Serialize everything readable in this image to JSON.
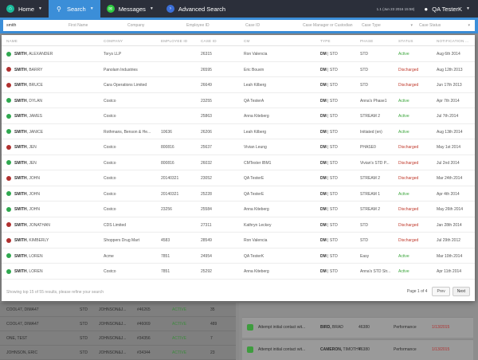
{
  "nav": {
    "home": "Home",
    "search": "Search",
    "messages": "Messages",
    "advanced_search": "Advanced Search",
    "version": "1.1 (Jun 23 2016 15:58)",
    "user": "QA TesterK"
  },
  "search": {
    "query": "smith",
    "first_name": "First Name",
    "company": "Company",
    "employee_id": "Employee ID",
    "case_id": "Case ID",
    "case_manager": "Case Manager or Custodian",
    "case_type": "Case Type",
    "case_status": "Case Status"
  },
  "columns": {
    "name": "NAME",
    "company": "COMPANY",
    "employee_id": "EMPLOYEE ID",
    "case_id": "CASE ID",
    "cm": "CM",
    "type": "TYPE",
    "phase": "PHASE",
    "status": "STATUS",
    "notification": "NOTIFICATION ..."
  },
  "rows": [
    {
      "last": "SMITH",
      "first": "ALEXANDER",
      "company": "Torys LLP",
      "emp": "",
      "case": "26315",
      "cm": "Ron Valencia",
      "type_a": "DM",
      "type_b": "STD",
      "phase": "STD",
      "status": "Active",
      "notif": "Aug 6th 2014",
      "color": "#2fa84f"
    },
    {
      "last": "SMITH",
      "first": "BARRY",
      "company": "Panolam Industries",
      "emp": "",
      "case": "26595",
      "cm": "Eric Bouvin",
      "type_a": "DM",
      "type_b": "STD",
      "phase": "STD",
      "status": "Discharged",
      "notif": "Aug 12th 2013",
      "color": "#b0302f"
    },
    {
      "last": "SMITH",
      "first": "BRUCE",
      "company": "Cara Operations Limited",
      "emp": "",
      "case": "26649",
      "cm": "Leah Kilberg",
      "type_a": "DM",
      "type_b": "STD",
      "phase": "STD",
      "status": "Discharged",
      "notif": "Jun 17th 2013",
      "color": "#b0302f"
    },
    {
      "last": "SMITH",
      "first": "DYLAN",
      "company": "Costco",
      "emp": "",
      "case": "23255",
      "cm": "QA TesterA",
      "type_a": "DM",
      "type_b": "STD",
      "phase": "Anna's Phase1",
      "status": "Active",
      "notif": "Apr 7th 2014",
      "color": "#2fa84f"
    },
    {
      "last": "SMITH",
      "first": "JAMES",
      "company": "Costco",
      "emp": "",
      "case": "25863",
      "cm": "Anna Kiteberg",
      "type_a": "DM",
      "type_b": "STD",
      "phase": "STREAM 2",
      "status": "Active",
      "notif": "Jul 7th 2014",
      "color": "#2fa84f"
    },
    {
      "last": "SMITH",
      "first": "JANICE",
      "company": "Rothmans, Benson & He...",
      "emp": "10636",
      "case": "26206",
      "cm": "Leah Kilberg",
      "type_a": "DM",
      "type_b": "STD",
      "phase": "Initiated (en)",
      "status": "Active",
      "notif": "Aug 13th 2014",
      "color": "#2fa84f"
    },
    {
      "last": "SMITH",
      "first": "JEN",
      "company": "Costco",
      "emp": "800816",
      "case": "25637",
      "cm": "Vivian Leung",
      "type_a": "DM",
      "type_b": "STD",
      "phase": "PHASE0",
      "status": "Discharged",
      "notif": "May 1st 2014",
      "color": "#b0302f"
    },
    {
      "last": "SMITH",
      "first": "JEN",
      "company": "Costco",
      "emp": "800816",
      "case": "26032",
      "cm": "CMTester IBM1",
      "type_a": "DM",
      "type_b": "STD",
      "phase": "Vivian's STD P...",
      "status": "Discharged",
      "notif": "Jul 2nd 2014",
      "color": "#2fa84f"
    },
    {
      "last": "SMITH",
      "first": "JOHN",
      "company": "Costco",
      "emp": "20140321",
      "case": "23052",
      "cm": "QA TesterE",
      "type_a": "DM",
      "type_b": "STD",
      "phase": "STREAM 2",
      "status": "Discharged",
      "notif": "Mar 24th 2014",
      "color": "#b0302f"
    },
    {
      "last": "SMITH",
      "first": "JOHN",
      "company": "Costco",
      "emp": "20140321",
      "case": "25228",
      "cm": "QA TesterE",
      "type_a": "DM",
      "type_b": "STD",
      "phase": "STREAM 1",
      "status": "Active",
      "notif": "Apr 4th 2014",
      "color": "#2fa84f"
    },
    {
      "last": "SMITH",
      "first": "JOHN",
      "company": "Costco",
      "emp": "23256",
      "case": "25584",
      "cm": "Anna Kiteberg",
      "type_a": "DM",
      "type_b": "STD",
      "phase": "STREAM 2",
      "status": "Discharged",
      "notif": "May 26th 2014",
      "color": "#2fa84f"
    },
    {
      "last": "SMITH",
      "first": "JONATHAN",
      "company": "CDS Limited",
      "emp": "",
      "case": "27311",
      "cm": "Kathryn Leckey",
      "type_a": "DM",
      "type_b": "STD",
      "phase": "STD",
      "status": "Discharged",
      "notif": "Jan 28th 2014",
      "color": "#b0302f"
    },
    {
      "last": "SMITH",
      "first": "KIMBERLY",
      "company": "Shoppers Drug Mart",
      "emp": "4583",
      "case": "28549",
      "cm": "Ron Valencia",
      "type_a": "DM",
      "type_b": "STD",
      "phase": "STD",
      "status": "Discharged",
      "notif": "Jul 29th 2012",
      "color": "#b0302f"
    },
    {
      "last": "SMITH",
      "first": "LOREN",
      "company": "Acme",
      "emp": "7851",
      "case": "24954",
      "cm": "QA TesterK",
      "type_a": "DM",
      "type_b": "STD",
      "phase": "Easy",
      "status": "Active",
      "notif": "Mar 10th 2014",
      "color": "#2fa84f"
    },
    {
      "last": "SMITH",
      "first": "LOREN",
      "company": "Costco",
      "emp": "7851",
      "case": "25292",
      "cm": "Anna Kiteberg",
      "type_a": "DM",
      "type_b": "STD",
      "phase": "Anna's STD Str...",
      "status": "Active",
      "notif": "Apr 11th 2014",
      "color": "#2fa84f"
    }
  ],
  "footer": {
    "info": "Showing top 15 of 55 results, please refine your search",
    "page": "Page 1 of 4",
    "prev": "Prev",
    "next": "Next"
  },
  "bg_rows": [
    {
      "name": "COOL47, DIMA47",
      "type": "STD",
      "company": "JOHNSON&J...",
      "case": "#46265",
      "status": "ACTIVE",
      "count": "35"
    },
    {
      "name": "COOL47, DIMA47",
      "type": "STD",
      "company": "JOHNSON&J...",
      "case": "#46069",
      "status": "ACTIVE",
      "count": "489"
    },
    {
      "name": "ONE, TEST",
      "type": "STD",
      "company": "JOHNSON&J...",
      "case": "#34356",
      "status": "ACTIVE",
      "count": "7"
    },
    {
      "name": "JOHNSON, ERIC",
      "type": "STD",
      "company": "JOHNSON&J...",
      "case": "#34344",
      "status": "ACTIVE",
      "count": "23"
    }
  ],
  "bg_cards": [
    {
      "text": "Attempt initial contact wit...",
      "who_last": "BIRD,",
      "who_first": "BRAD",
      "num": "46380",
      "kind": "Performance",
      "date": "1/13/2015"
    },
    {
      "text": "Attempt initial contact wit...",
      "who_last": "CAMERON,",
      "who_first": "TIMOTHY",
      "num": "46380",
      "kind": "Performance",
      "date": "1/13/2015"
    }
  ]
}
